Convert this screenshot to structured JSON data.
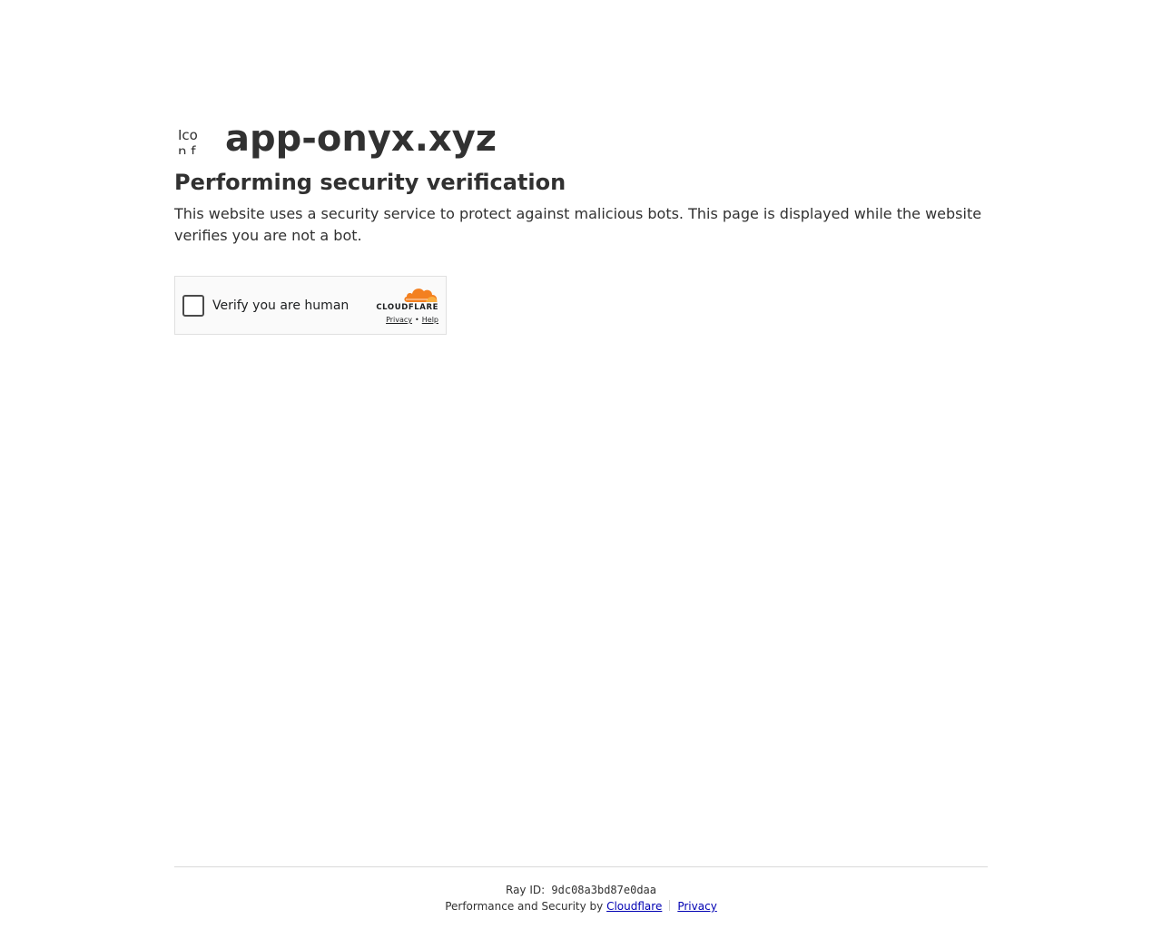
{
  "site": {
    "favicon_alt": "Icon for app-onyx.xyz",
    "name": "app-onyx.xyz"
  },
  "main": {
    "heading": "Performing security verification",
    "description": "This website uses a security service to protect against malicious bots. This page is displayed while the website verifies you are not a bot."
  },
  "widget": {
    "checkbox_label": "Verify you are human",
    "brand": "CLOUDFLARE",
    "privacy_link": "Privacy",
    "separator": "•",
    "help_link": "Help"
  },
  "footer": {
    "ray_label": "Ray ID:",
    "ray_id": "9dc08a3bd87e0daa",
    "performance_text": "Performance and Security by",
    "cloudflare_link": "Cloudflare",
    "privacy_link": "Privacy"
  },
  "colors": {
    "text": "#313131",
    "link": "#0000b3",
    "cloudflare_orange": "#f38020",
    "cloudflare_light_orange": "#faae40"
  },
  "icons": {
    "favicon": "broken-image-icon",
    "cloud": "cloudflare-cloud-icon"
  }
}
